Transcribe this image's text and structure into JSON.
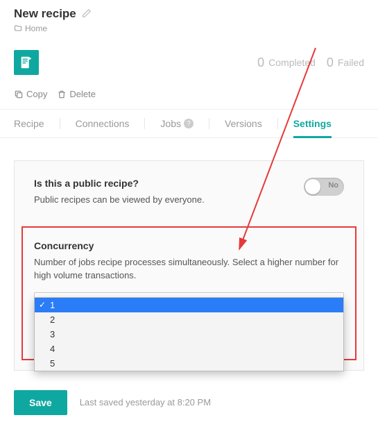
{
  "header": {
    "title": "New recipe",
    "breadcrumb_home": "Home"
  },
  "stats": {
    "completed_count": "0",
    "completed_label": "Completed",
    "failed_count": "0",
    "failed_label": "Failed"
  },
  "actions": {
    "copy": "Copy",
    "delete": "Delete"
  },
  "tabs": {
    "recipe": "Recipe",
    "connections": "Connections",
    "jobs": "Jobs",
    "versions": "Versions",
    "settings": "Settings"
  },
  "public_section": {
    "title": "Is this a public recipe?",
    "desc": "Public recipes can be viewed by everyone.",
    "toggle_label": "No"
  },
  "concurrency": {
    "title": "Concurrency",
    "desc": "Number of jobs recipe processes simultaneously. Select a higher number for high volume transactions.",
    "options": [
      "1",
      "2",
      "3",
      "4",
      "5"
    ],
    "selected": "1"
  },
  "footer": {
    "save": "Save",
    "last_saved": "Last saved yesterday at 8:20 PM"
  }
}
